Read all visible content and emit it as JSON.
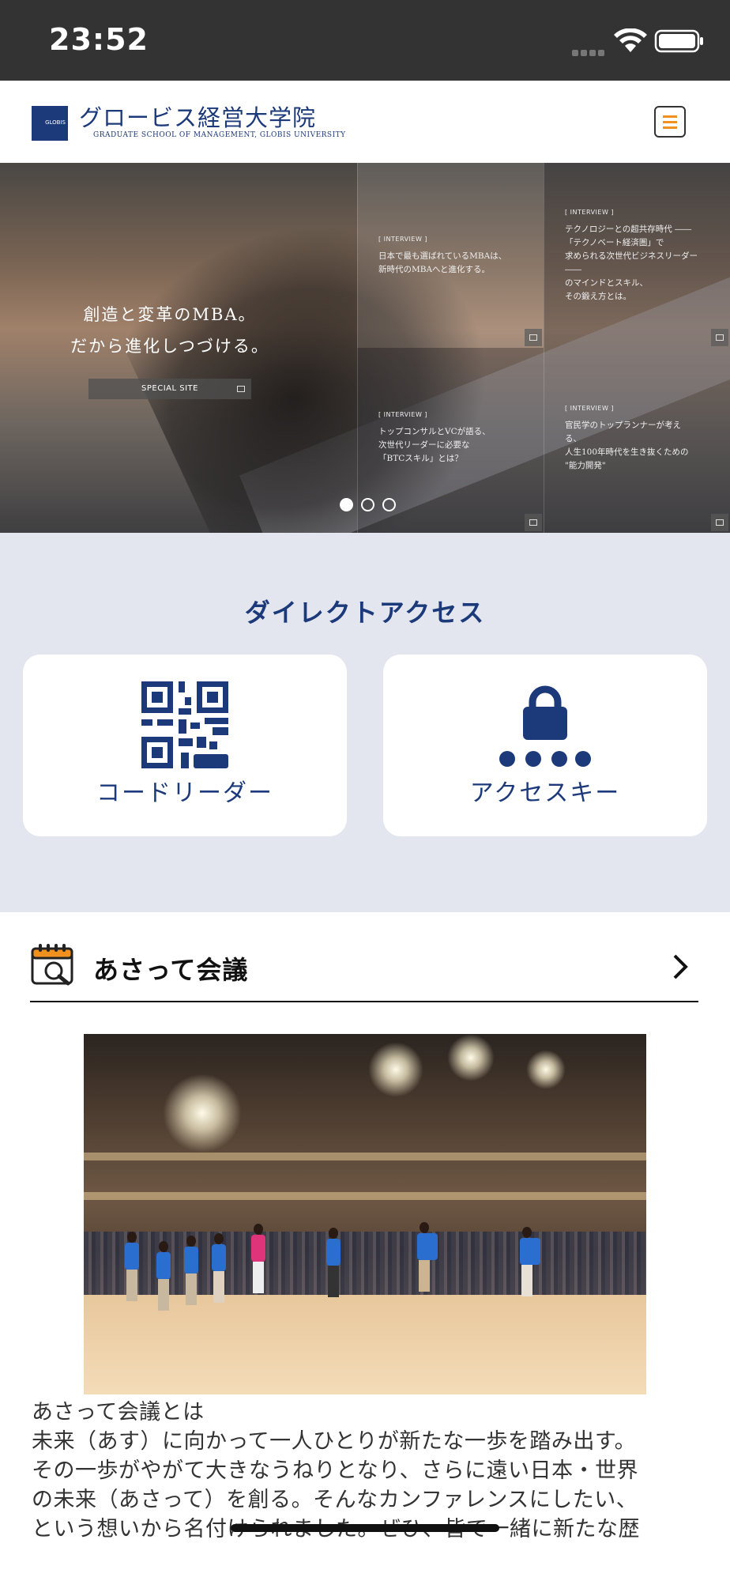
{
  "status_bar": {
    "time": "23:52"
  },
  "header": {
    "logo_text": "GLOBIS",
    "title": "グロービス経営大学院",
    "subtitle": "GRADUATE SCHOOL OF MANAGEMENT, GLOBIS UNIVERSITY"
  },
  "hero": {
    "tagline": [
      "創造と変革のMBA。",
      "だから進化しつづける。"
    ],
    "special_site": "SPECIAL SITE",
    "panels": [
      {
        "tag": "[ INTERVIEW ]",
        "text": "日本で最も選ばれているMBAは、\n新時代のMBAへと進化する。"
      },
      {
        "tag": "[ INTERVIEW ]",
        "text": "テクノロジーとの超共存時代 ――\n「テクノベート経済圏」で\n求められる次世代ビジネスリーダー\n――\nのマインドとスキル、\nその鍛え方とは。"
      },
      {
        "tag": "[ INTERVIEW ]",
        "text": "トップコンサルとVCが語る、\n次世代リーダーに必要な\n「BTCスキル」とは？"
      },
      {
        "tag": "[ INTERVIEW ]",
        "text": "官民学のトップランナーが考え\nる、\n人生100年時代を生き抜くための\n\"能力開発\""
      }
    ],
    "slide_count": 3,
    "active_slide": 1
  },
  "direct_access": {
    "title": "ダイレクトアクセス",
    "cards": [
      {
        "label": "コードリーダー",
        "icon": "qr-code-icon"
      },
      {
        "label": "アクセスキー",
        "icon": "lock-icon"
      }
    ]
  },
  "asatte": {
    "title": "あさって会議",
    "icon": "calendar-search-icon",
    "body_lines": [
      "あさって会議とは",
      "未来（あす）に向かって一人ひとりが新たな一歩を踏み出す。",
      "その一歩がやがて大きなうねりとなり、さらに遠い日本・世界",
      "の未来（あさって）を創る。そんなカンファレンスにしたい、",
      "という想いから名付けられました。ぜひ、皆で一緒に新たな歴"
    ]
  },
  "colors": {
    "brand_navy": "#1c3a7a",
    "accent_orange": "#f0901e",
    "section_bg": "#e3e6ef"
  }
}
